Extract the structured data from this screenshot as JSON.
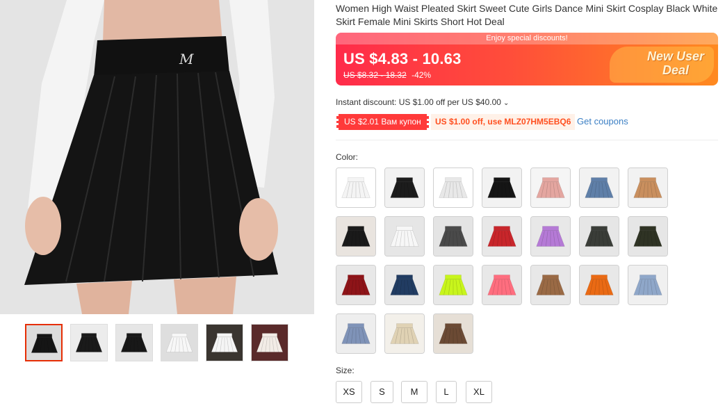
{
  "product": {
    "title": "Women High Waist Pleated Skirt Sweet Cute Girls Dance Mini Skirt Cosplay Black White Skirt Female Mini Skirts Short Hot Deal"
  },
  "price": {
    "banner_note": "Enjoy special discounts!",
    "current": "US $4.83 - 10.63",
    "original": "US $8.32 - 18.32",
    "discount": "-42%",
    "promo_line1": "New User",
    "promo_line2": "Deal",
    "colors": {
      "banner_start": "#ff2b4a",
      "banner_end": "#ff8a1f"
    }
  },
  "discounts": {
    "instant": "Instant discount: US $1.00 off per US $40.00",
    "coupon_ru": "US $2.01 Вам купон",
    "coupon_code": "US $1.00 off, use MLZ07HM5EBQ6",
    "get_coupons": "Get coupons"
  },
  "options": {
    "color_label": "Color:",
    "size_label": "Size:",
    "sizes": [
      "XS",
      "S",
      "M",
      "L",
      "XL"
    ],
    "color_swatches": [
      {
        "skirt": "#f4f4f4",
        "bg": "#ffffff"
      },
      {
        "skirt": "#1c1c1c",
        "bg": "#f2f2f2"
      },
      {
        "skirt": "#e8e8e8",
        "bg": "#ffffff"
      },
      {
        "skirt": "#151515",
        "bg": "#f2f2f2"
      },
      {
        "skirt": "#e4a6a0",
        "bg": "#f5f5f5"
      },
      {
        "skirt": "#5f7fa8",
        "bg": "#f2f2f2"
      },
      {
        "skirt": "#c98f5e",
        "bg": "#f2f2f2"
      },
      {
        "skirt": "#1a1a1a",
        "bg": "#e9e4df"
      },
      {
        "skirt": "#f7f7f7",
        "bg": "#e6e6e6"
      },
      {
        "skirt": "#4a4a4a",
        "bg": "#e4e4e4"
      },
      {
        "skirt": "#c8262b",
        "bg": "#e8e8e8"
      },
      {
        "skirt": "#b57ad6",
        "bg": "#e8e8e8"
      },
      {
        "skirt": "#3a3d38",
        "bg": "#e6e6e6"
      },
      {
        "skirt": "#2f3324",
        "bg": "#e6e6e6"
      },
      {
        "skirt": "#8e1418",
        "bg": "#e8e8e8"
      },
      {
        "skirt": "#213c62",
        "bg": "#e8e8e8"
      },
      {
        "skirt": "#c8f51c",
        "bg": "#e8e8e8"
      },
      {
        "skirt": "#ff6e7f",
        "bg": "#e8e8e8"
      },
      {
        "skirt": "#9a6a45",
        "bg": "#e8e8e8"
      },
      {
        "skirt": "#ea6a14",
        "bg": "#e8e8e8"
      },
      {
        "skirt": "#8fa7c9",
        "bg": "#f0f0f0"
      },
      {
        "skirt": "#7f93b8",
        "bg": "#eeeeee"
      },
      {
        "skirt": "#e0d2b4",
        "bg": "#f3f0ea"
      },
      {
        "skirt": "#6b4a34",
        "bg": "#e6dfd6"
      }
    ]
  },
  "gallery": {
    "thumbnails": [
      {
        "skirt": "#151515",
        "bg": "#dcdcdc"
      },
      {
        "skirt": "#1a1a1a",
        "bg": "#ececec"
      },
      {
        "skirt": "#181818",
        "bg": "#e6e6e6"
      },
      {
        "skirt": "#f7f7f7",
        "bg": "#dedede"
      },
      {
        "skirt": "#f5f5f5",
        "bg": "#3a3530"
      },
      {
        "skirt": "#f2ece6",
        "bg": "#5a2a2a"
      }
    ],
    "accent": "#e62e04"
  }
}
